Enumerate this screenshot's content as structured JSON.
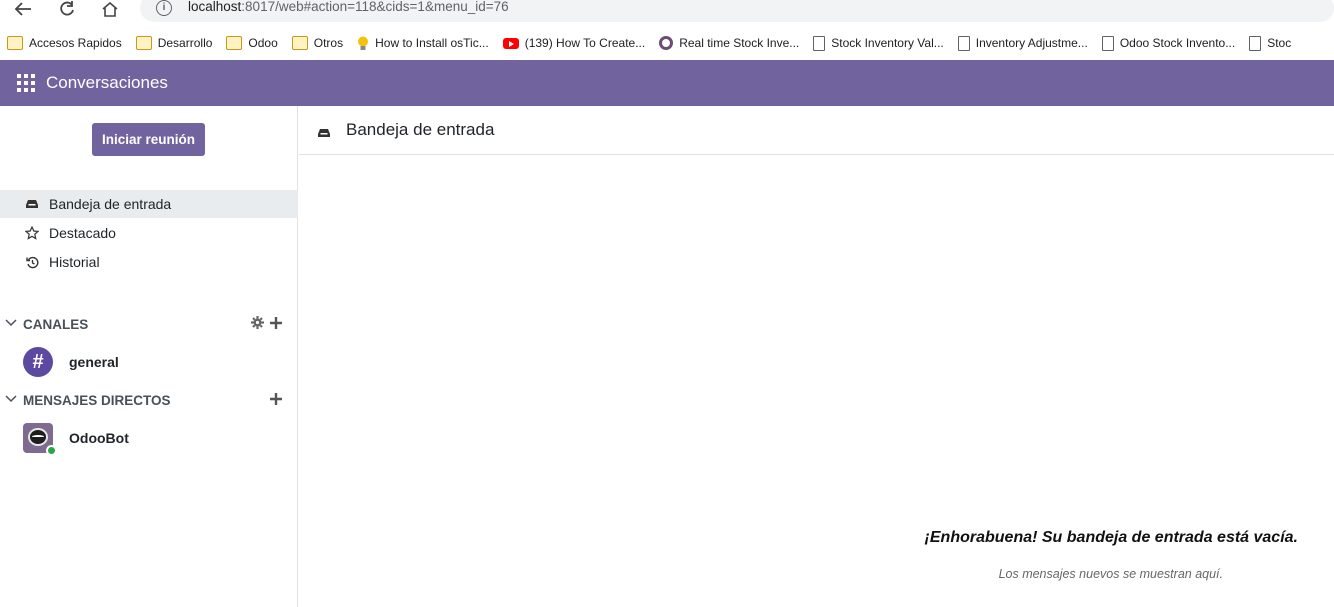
{
  "browser": {
    "url_host": "localhost",
    "url_rest": ":8017/web#action=118&cids=1&menu_id=76",
    "bookmarks": [
      {
        "label": "Accesos Rapidos",
        "icon": "folder-icon"
      },
      {
        "label": "Desarrollo",
        "icon": "folder-icon"
      },
      {
        "label": "Odoo",
        "icon": "folder-icon"
      },
      {
        "label": "Otros",
        "icon": "folder-icon"
      },
      {
        "label": "How to Install osTic...",
        "icon": "lightbulb-icon"
      },
      {
        "label": "(139) How To Create...",
        "icon": "youtube-icon"
      },
      {
        "label": "Real time Stock Inve...",
        "icon": "ring-icon"
      },
      {
        "label": "Stock Inventory Val...",
        "icon": "page-icon"
      },
      {
        "label": "Inventory Adjustme...",
        "icon": "page-icon"
      },
      {
        "label": "Odoo Stock Invento...",
        "icon": "page-icon"
      },
      {
        "label": "Stoc",
        "icon": "page-icon"
      }
    ]
  },
  "navbar": {
    "app_title": "Conversaciones",
    "brand_color": "#71639e"
  },
  "sidebar": {
    "start_meeting": "Iniciar reunión",
    "mailboxes": [
      {
        "label": "Bandeja de entrada",
        "icon": "inbox-icon",
        "active": true
      },
      {
        "label": "Destacado",
        "icon": "star-icon",
        "active": false
      },
      {
        "label": "Historial",
        "icon": "history-icon",
        "active": false
      }
    ],
    "channels_header": "CANALES",
    "channels": [
      {
        "label": "general",
        "icon": "hash-icon"
      }
    ],
    "direct_header": "MENSAJES DIRECTOS",
    "direct_messages": [
      {
        "label": "OdooBot",
        "icon": "odoobot-avatar",
        "status": "online"
      }
    ]
  },
  "main": {
    "title": "Bandeja de entrada",
    "empty_title": "¡Enhorabuena! Su bandeja de entrada está vacía.",
    "empty_subtitle": "Los mensajes nuevos se muestran aquí."
  }
}
